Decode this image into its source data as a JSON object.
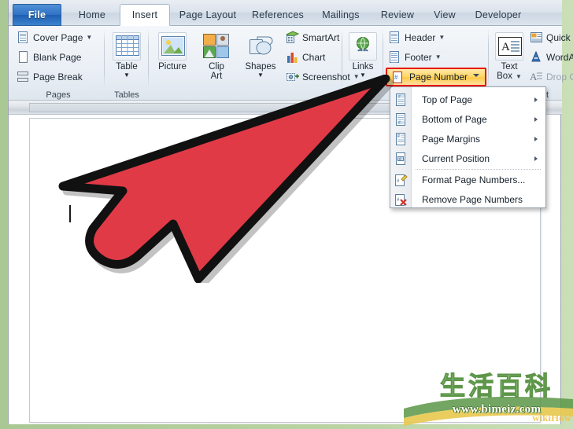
{
  "app": {
    "tabs": [
      {
        "label": "File",
        "state": "file"
      },
      {
        "label": "Home",
        "state": "normal"
      },
      {
        "label": "Insert",
        "state": "active"
      },
      {
        "label": "Page Layout",
        "state": "normal"
      },
      {
        "label": "References",
        "state": "normal"
      },
      {
        "label": "Mailings",
        "state": "normal"
      },
      {
        "label": "Review",
        "state": "normal"
      },
      {
        "label": "View",
        "state": "normal"
      },
      {
        "label": "Developer",
        "state": "normal"
      }
    ]
  },
  "ribbon": {
    "groups": [
      {
        "name": "Pages",
        "label": "Pages"
      },
      {
        "name": "Tables",
        "label": "Tables"
      },
      {
        "name": "Illustrations",
        "label": ""
      },
      {
        "name": "Links",
        "label": ""
      },
      {
        "name": "HeaderFooter",
        "label": ""
      },
      {
        "name": "Text",
        "label": "Text"
      }
    ],
    "pages": {
      "cover_page": "Cover Page",
      "blank_page": "Blank Page",
      "page_break": "Page Break"
    },
    "tables": {
      "table": "Table"
    },
    "illustrations": {
      "picture": "Picture",
      "clip_art_line1": "Clip",
      "clip_art_line2": "Art",
      "shapes": "Shapes",
      "smartart": "SmartArt",
      "chart": "Chart",
      "screenshot": "Screenshot"
    },
    "links": {
      "links": "Links"
    },
    "header_footer": {
      "header": "Header",
      "footer": "Footer",
      "page_number": "Page Number"
    },
    "text": {
      "text_box_line1": "Text",
      "text_box_line2": "Box",
      "quick_parts": "Quick P",
      "wordart": "WordA",
      "drop_cap": "Drop C",
      "group_label": "Text"
    }
  },
  "menu": {
    "items": [
      {
        "label": "Top of Page",
        "icon": "page-number-top-icon",
        "submenu": true
      },
      {
        "label": "Bottom of Page",
        "icon": "page-number-bottom-icon",
        "submenu": true
      },
      {
        "label": "Page Margins",
        "icon": "page-number-margins-icon",
        "submenu": true
      },
      {
        "label": "Current Position",
        "icon": "page-number-current-icon",
        "submenu": true
      },
      {
        "label": "Format Page Numbers...",
        "icon": "format-page-numbers-icon",
        "submenu": false
      },
      {
        "label": "Remove Page Numbers",
        "icon": "remove-page-numbers-icon",
        "submenu": false
      }
    ]
  },
  "annotation": {
    "arrow_color": "#e03a46",
    "arrow_outline": "#111111",
    "highlight_border": "#e8120c",
    "highlight_fill": "#ffd76a"
  },
  "watermark": {
    "cjk": "生活百科",
    "url": "www.bimeiz.com",
    "ghost": "wikiHow"
  },
  "theme": {
    "frame_green": "#b4cf9b",
    "file_tab_blue": "#2f72c4",
    "ribbon_bg": "#eaeff5"
  }
}
